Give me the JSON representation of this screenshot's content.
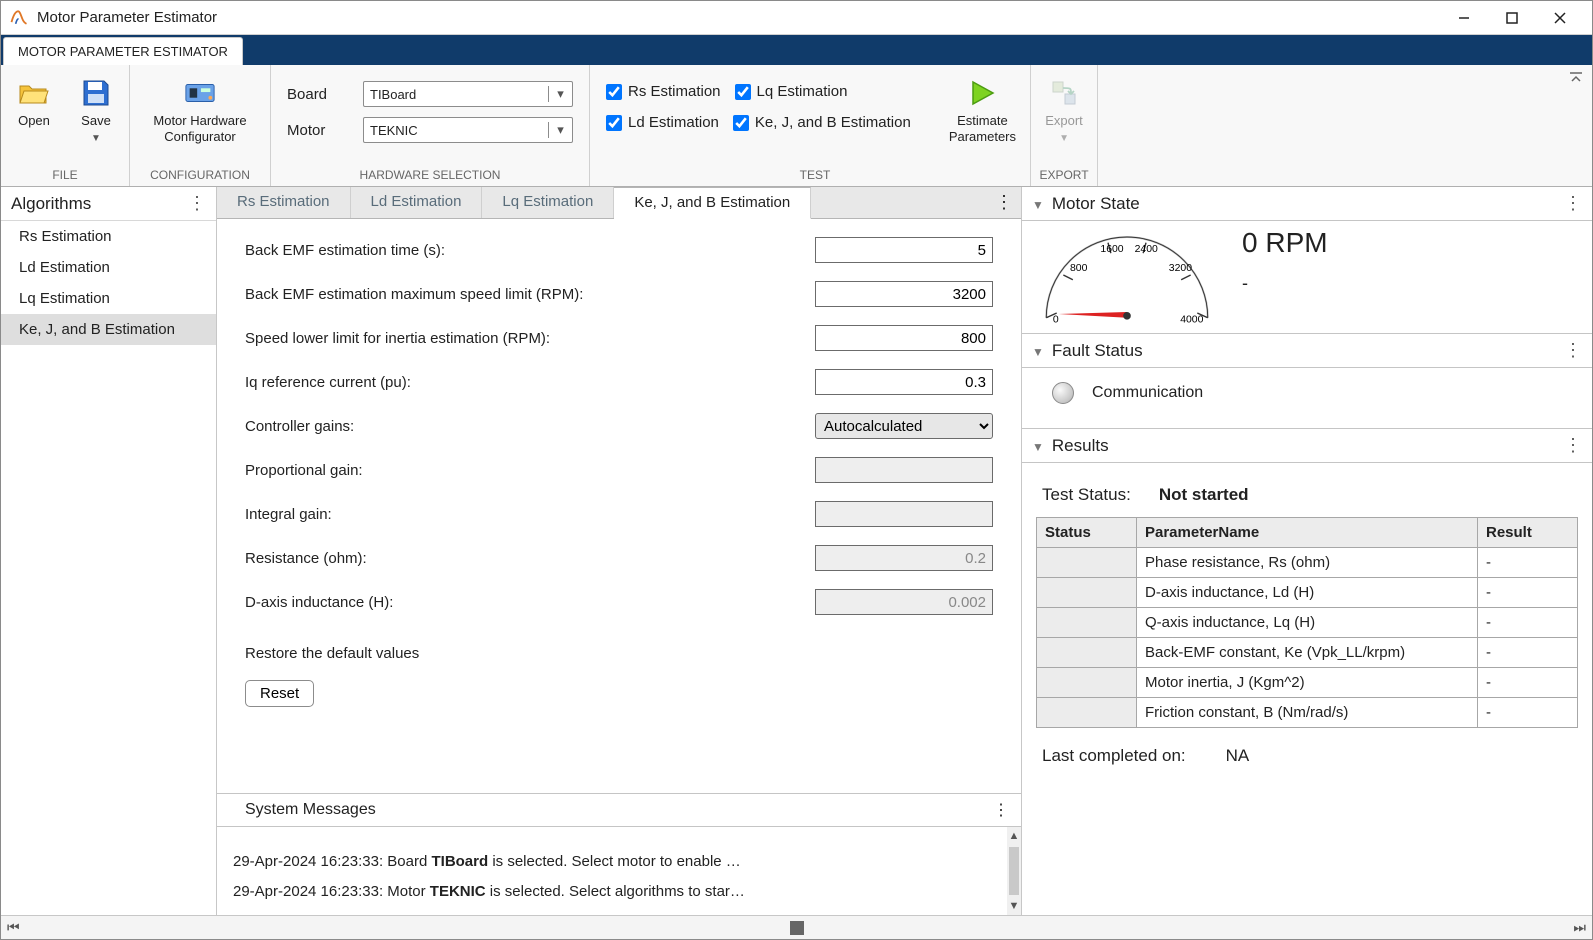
{
  "window": {
    "title": "Motor Parameter Estimator"
  },
  "ribbon": {
    "main_tab": "MOTOR PARAMETER ESTIMATOR",
    "file": {
      "open": "Open",
      "save": "Save",
      "group": "FILE"
    },
    "config": {
      "btn": "Motor Hardware Configurator",
      "btn_line1": "Motor Hardware",
      "btn_line2": "Configurator",
      "group": "CONFIGURATION"
    },
    "hw": {
      "board_label": "Board",
      "board_value": "TIBoard",
      "motor_label": "Motor",
      "motor_value": "TEKNIC",
      "group": "HARDWARE SELECTION"
    },
    "test": {
      "rs": "Rs Estimation",
      "ld": "Ld Estimation",
      "lq": "Lq Estimation",
      "kejb": "Ke, J, and B Estimation",
      "estimate_line1": "Estimate",
      "estimate_line2": "Parameters",
      "group": "TEST"
    },
    "export": {
      "btn": "Export",
      "group": "EXPORT"
    }
  },
  "left": {
    "title": "Algorithms",
    "items": [
      "Rs Estimation",
      "Ld Estimation",
      "Lq Estimation",
      "Ke, J, and B Estimation"
    ],
    "selected_index": 3
  },
  "tabs": {
    "items": [
      "Rs Estimation",
      "Ld Estimation",
      "Lq Estimation",
      "Ke, J, and B Estimation"
    ],
    "active_index": 3
  },
  "form": {
    "rows": [
      {
        "label": "Back EMF estimation time (s):",
        "value": "5",
        "type": "text"
      },
      {
        "label": "Back EMF estimation maximum speed limit (RPM):",
        "value": "3200",
        "type": "text"
      },
      {
        "label": "Speed lower limit for inertia estimation (RPM):",
        "value": "800",
        "type": "text"
      },
      {
        "label": "Iq reference current (pu):",
        "value": "0.3",
        "type": "text"
      },
      {
        "label": "Controller gains:",
        "value": "Autocalculated",
        "type": "select"
      },
      {
        "label": "Proportional gain:",
        "value": "",
        "type": "text",
        "disabled": true
      },
      {
        "label": "Integral gain:",
        "value": "",
        "type": "text",
        "disabled": true
      },
      {
        "label": "Resistance (ohm):",
        "value": "0.2",
        "type": "text",
        "disabled": true
      },
      {
        "label": "D-axis inductance (H):",
        "value": "0.002",
        "type": "text",
        "disabled": true
      }
    ],
    "restore_label": "Restore the default values",
    "reset_btn": "Reset"
  },
  "sysmsg": {
    "title": "System Messages",
    "lines": [
      {
        "prefix": "29-Apr-2024 16:23:33: Board ",
        "bold": "TIBoard",
        "suffix": " is selected. Select motor to enable …"
      },
      {
        "prefix": "29-Apr-2024 16:23:33: Motor ",
        "bold": "TEKNIC",
        "suffix": " is selected. Select algorithms to star…"
      }
    ]
  },
  "right": {
    "motor_state": {
      "title": "Motor State",
      "rpm": "0 RPM",
      "status": "-",
      "ticks": [
        "0",
        "800",
        "1600",
        "2400",
        "3200",
        "4000"
      ]
    },
    "fault": {
      "title": "Fault Status",
      "label": "Communication"
    },
    "results": {
      "title": "Results",
      "test_status_label": "Test Status:",
      "test_status_value": "Not started",
      "columns": [
        "Status",
        "ParameterName",
        "Result"
      ],
      "rows": [
        {
          "status": "",
          "name": "Phase resistance, Rs (ohm)",
          "result": "-"
        },
        {
          "status": "",
          "name": "D-axis inductance, Ld (H)",
          "result": "-"
        },
        {
          "status": "",
          "name": "Q-axis inductance, Lq (H)",
          "result": "-"
        },
        {
          "status": "",
          "name": "Back-EMF constant, Ke (Vpk_LL/krpm)",
          "result": "-"
        },
        {
          "status": "",
          "name": "Motor inertia, J (Kgm^2)",
          "result": "-"
        },
        {
          "status": "",
          "name": "Friction constant, B (Nm/rad/s)",
          "result": "-"
        }
      ],
      "last_label": "Last completed on:",
      "last_value": "NA"
    }
  }
}
